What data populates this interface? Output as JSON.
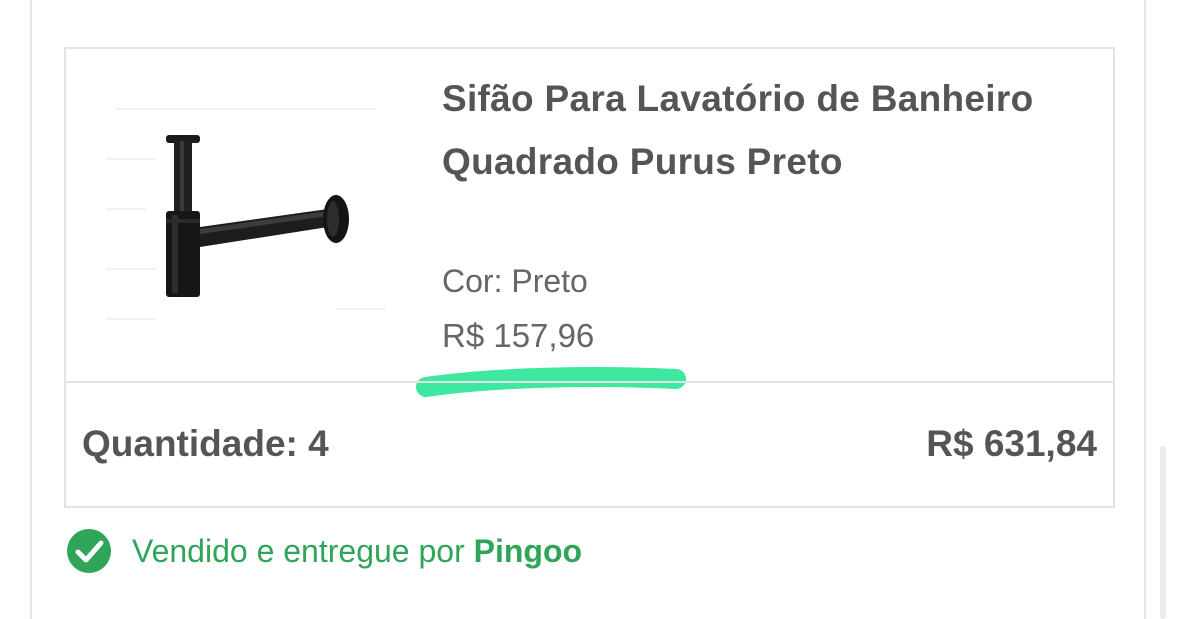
{
  "product": {
    "title": "Sifão Para Lavatório de Banheiro Quadrado Purus Preto",
    "color_label": "Cor: Preto",
    "unit_price": "R$ 157,96",
    "image_icon": "drain-trap-product-image"
  },
  "summary": {
    "quantity_label": "Quantidade: 4",
    "line_total": "R$ 631,84"
  },
  "seller": {
    "prefix": "Vendido e entregue por ",
    "name": "Pingoo",
    "icon": "check-circle-icon"
  },
  "colors": {
    "accent_green": "#2fa55a",
    "highlight_mark": "#3ee8a0",
    "text_dark": "#555555",
    "border": "#e3e3e3"
  }
}
